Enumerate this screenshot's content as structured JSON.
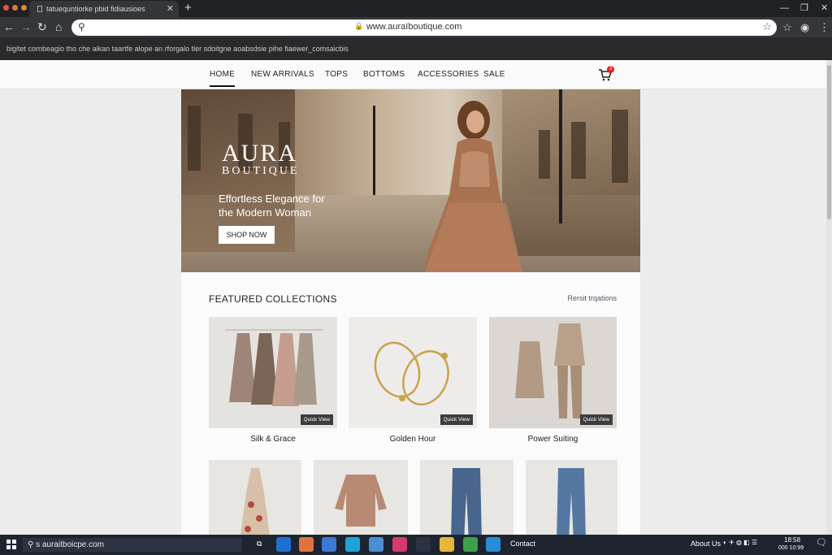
{
  "browser": {
    "tab_title": "tatuequntiorke pbid fidiausioes",
    "url": "www.auraIboutique.com",
    "bookmark_text": "bigitet cornbeagio tho che aikan taartfe alope an rforgalo tler sdoitgne aoabsdsie pihe fiaewer_comsaicbis"
  },
  "nav": {
    "items": [
      "HOME",
      "NEW ARRIVALS",
      "TOPS",
      "BOTTOMS",
      "ACCESSORIES",
      "SALE"
    ],
    "cart_count": "3"
  },
  "hero": {
    "brand_line1": "AURA",
    "brand_line2": "BOUTIQUE",
    "tagline": "Effortless Elegance for the Modern Woman",
    "cta": "SHOP NOW"
  },
  "featured": {
    "title": "FEATURED COLLECTIONS",
    "link": "Rersit trqations",
    "quick_view": "Quick View",
    "collections": [
      "Silk & Grace",
      "Golden Hour",
      "Power Suiting"
    ]
  },
  "taskbar": {
    "search_text": "s auraitboicpe.com",
    "contact": "Contact",
    "about": "About Us",
    "time": "18:58",
    "date": "000 10:99"
  },
  "colors": {
    "accent_badge": "#dd2222",
    "taskbar": "#1d2430",
    "chrome": "#35363a"
  }
}
